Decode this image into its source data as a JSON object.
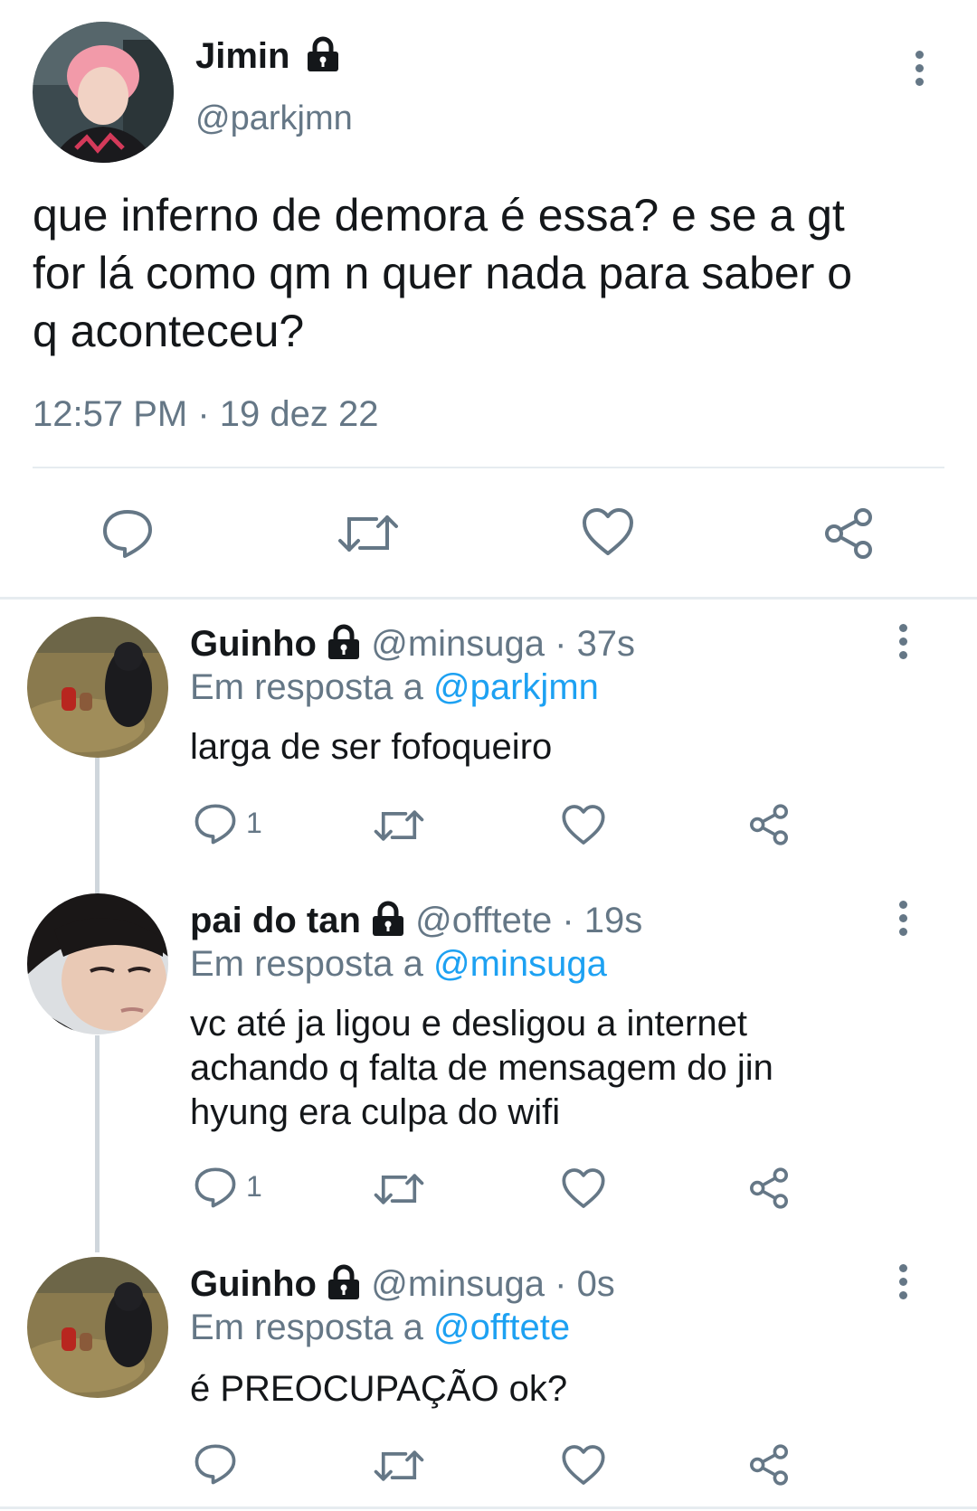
{
  "main": {
    "name": "Jimin",
    "handle": "@parkjmn",
    "text_lines": [
      "que inferno de demora é essa? e se a gt",
      "for lá como qm n quer nada para saber o",
      "q aconteceu?"
    ],
    "timestamp": "12:57 PM · 19 dez 22"
  },
  "replies": [
    {
      "name": "Guinho",
      "handle_time": "@minsuga · 37s",
      "reply_prefix": "Em resposta a",
      "reply_to": "@parkjmn",
      "text_lines": [
        "larga de ser fofoqueiro"
      ],
      "reply_count": "1"
    },
    {
      "name": "pai do tan",
      "handle_time": "@offtete · 19s",
      "reply_prefix": "Em resposta a",
      "reply_to": "@minsuga",
      "text_lines": [
        "vc até ja ligou e desligou a internet",
        "achando q falta de mensagem do jin",
        "hyung era culpa do wifi"
      ],
      "reply_count": "1"
    },
    {
      "name": "Guinho",
      "handle_time": "@minsuga · 0s",
      "reply_prefix": "Em resposta a",
      "reply_to": "@offtete",
      "text_lines": [
        "é PREOCUPAÇÃO ok?"
      ],
      "reply_count": ""
    }
  ],
  "icons": {
    "lock": "lock-icon",
    "more": "more-vertical-icon",
    "reply": "reply-icon",
    "retweet": "retweet-icon",
    "like": "heart-icon",
    "share": "share-icon"
  },
  "colors": {
    "text": "#14171a",
    "muted": "#657786",
    "link": "#1da1f2",
    "divider": "#e6ecf0"
  }
}
